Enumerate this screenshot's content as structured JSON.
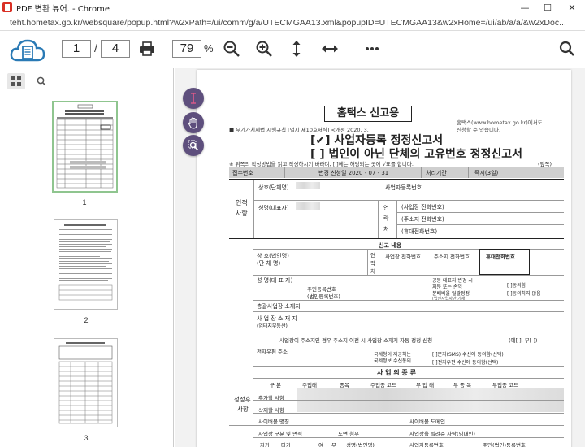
{
  "window": {
    "title": "PDF 변환 뷰어. - Chrome",
    "minimize": "—",
    "maximize": "☐",
    "close": "✕"
  },
  "address": {
    "url": "teht.hometax.go.kr/websquare/popup.html?w2xPath=/ui/comm/g/a/UTECMGAA13.xml&popupID=UTECMGAA13&w2xHome=/ui/ab/a/a/&w2xDoc..."
  },
  "toolbar": {
    "current_page": "1",
    "separator": "/",
    "total_pages": "4",
    "zoom_value": "79",
    "zoom_unit": "%"
  },
  "thumbnails": [
    {
      "label": "1"
    },
    {
      "label": "2"
    },
    {
      "label": "3"
    }
  ],
  "document": {
    "stamp": "홈택스 신고용",
    "site_line1": "홈택스(www.hometax.go.kr)에서도",
    "site_line2": "신청할 수 있습니다.",
    "law_ref": "■ 부가가치세법 시행규칙 [별지 제10호서식] <개정 2020. 3.",
    "title1": "[✔] 사업자등록 정정신고서",
    "title2": "[  ] 법인이 아닌 단체의 고유번호 정정신고서",
    "notice": "※ 뒤쪽의 작성방법을 읽고 작성하시기 바라며, [  ]에는 해당되는 곳에 √표를 합니다.",
    "notice_side": "(앞쪽)",
    "receipt_no": "접수번호",
    "receipt_date": "변경 신청일 2020 - 07 - 31",
    "processing": "처리기간",
    "processing_val": "즉시(3일)",
    "personal_label1": "인적",
    "personal_label2": "사항",
    "name_label": "상호(단체명)",
    "bizno_label": "사업자등록번호",
    "rep_label": "성명(대표자)",
    "contact1": "연",
    "contact2": "락",
    "contact3": "처",
    "office_phone": "(사업장 전화번호)",
    "home_phone": "(주소지 전화번호)",
    "mobile_phone": "(휴대전화번호)",
    "report_section": "신고 내용",
    "name_row1": "상 호(법인명)",
    "name_row2": "(단 체 명)",
    "c_phone1": "사업장 전화번호",
    "c_phone2": "주소지 전화번호",
    "c_phone3": "휴대전화번호",
    "rep_row": "성 명(대 표 자)",
    "resident_no1": "주민등록번호",
    "resident_no2": "(법인등록번호)",
    "rep_change1": "공동 대표자 변경 시",
    "rep_change2": "지분 또는 손익",
    "rep_change3": "분배비율 일괄정정",
    "rep_change4": "(법인사업자만 기재)",
    "check_yes": "[ ]동의함",
    "check_no": "[ ]동의하지 않음",
    "biz_addr": "총괄사업장 소재지",
    "site_addr1": "사 업 장  소 재 지",
    "site_addr2": "(업태지부동산)",
    "notify": "사업장이 주소지인 경우 주소지 이전 시 사업장 소재지 자동 정정 신청",
    "notify_yn": "(예[ ], 부[ ])",
    "email_label": "전자우편 주소",
    "info1": "국세청이 제공하는",
    "info2": "국세정보 수신동의",
    "sms": "[ ]문자(SMS) 수신에 동의함(선택)",
    "email_agree": "[ ]전자우편 수신에 동의함(선택)",
    "biztype": "사 업 의  종 류",
    "col1": "구 분",
    "col2": "주업태",
    "col3": "종목",
    "col4": "주업종 코드",
    "col5": "부 업 태",
    "col6": "부 종 목",
    "col7": "부업종 코드",
    "change_label1": "정정후",
    "change_label2": "사항",
    "add_item": "추가할 사항",
    "del_item": "삭제할 사항",
    "open_date": "사이버몰 명칭",
    "domain": "사이버몰 도메인",
    "lease1": "사업장 구분 및 면적",
    "lease2": "도면 첨부",
    "lease3": "사업장을 빌려준 사람(임대인)",
    "last1": "자가",
    "last2": "타가",
    "last3": "여",
    "last4": "부",
    "last5": "성명(법인명)",
    "last6": "사업자등록번호",
    "last7": "주민(법인)등록번호"
  },
  "colors": {
    "fab": "#5e4f7d",
    "fab_cursor": "#e05a8a",
    "accent": "#2a7ab5",
    "thumb_selected": "#8fc58f"
  },
  "icons": {
    "logo": "cloud-document-icon",
    "print": "printer-icon",
    "zoom_out": "zoom-out-icon",
    "zoom_in": "zoom-in-icon",
    "fit_height": "fit-height-icon",
    "fit_width": "fit-width-icon",
    "more": "more-icon",
    "search": "search-icon"
  }
}
